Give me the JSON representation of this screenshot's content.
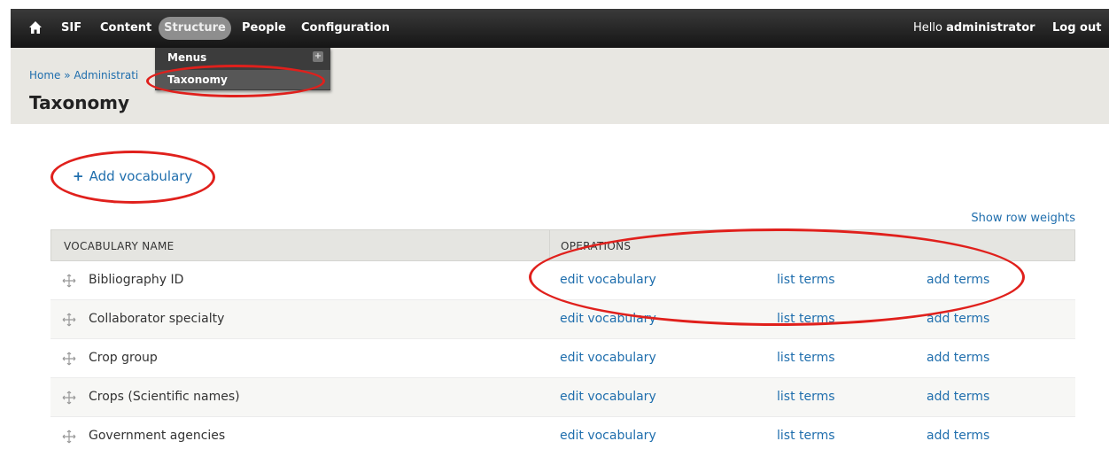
{
  "toolbar": {
    "nav": [
      "SIF",
      "Content",
      "Structure",
      "People",
      "Configuration"
    ],
    "greeting_prefix": "Hello ",
    "username": "administrator",
    "logout": "Log out"
  },
  "dropdown": {
    "items": [
      "Menus",
      "Taxonomy"
    ]
  },
  "header": {
    "breadcrumb": "Home » Administrati",
    "title": "Taxonomy"
  },
  "actions": {
    "add_vocabulary": "Add vocabulary",
    "show_row_weights": "Show row weights"
  },
  "table": {
    "headers": [
      "VOCABULARY NAME",
      "OPERATIONS"
    ],
    "rows": [
      {
        "name": "Bibliography ID",
        "edit": "edit vocabulary",
        "list": "list terms",
        "add": "add terms"
      },
      {
        "name": "Collaborator specialty",
        "edit": "edit vocabulary",
        "list": "list terms",
        "add": "add terms"
      },
      {
        "name": "Crop group",
        "edit": "edit vocabulary",
        "list": "list terms",
        "add": "add terms"
      },
      {
        "name": "Crops (Scientific names)",
        "edit": "edit vocabulary",
        "list": "list terms",
        "add": "add terms"
      },
      {
        "name": "Government agencies",
        "edit": "edit vocabulary",
        "list": "list terms",
        "add": "add terms"
      }
    ]
  },
  "colors": {
    "link": "#1f6ead",
    "annotation": "#e0201c",
    "toolbar": "#1c1c1c"
  },
  "icons": [
    "home-icon",
    "plus-icon",
    "drag-handle-icon"
  ]
}
